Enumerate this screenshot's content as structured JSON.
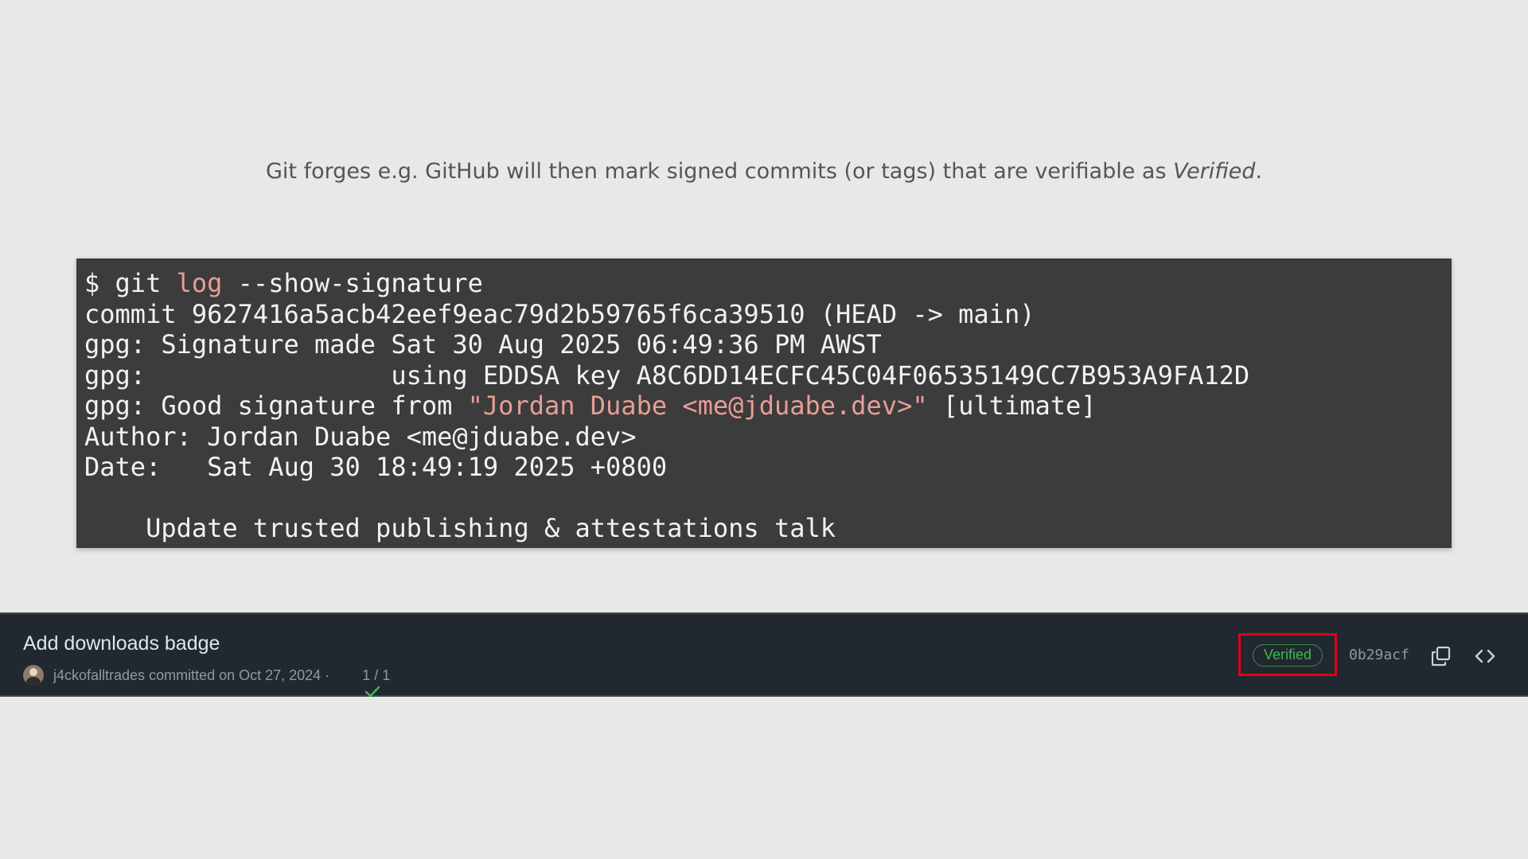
{
  "intro": {
    "text_before": "Git forges e.g. GitHub will then mark signed commits (or tags) that are verifiable as ",
    "emphasis": "Verified",
    "text_after": "."
  },
  "terminal": {
    "line1_prompt": "$ git ",
    "line1_cmd": "log",
    "line1_args": " --show-signature",
    "line2": "commit 9627416a5acb42eef9eac79d2b59765f6ca39510 (HEAD -> main)",
    "line3": "gpg: Signature made Sat 30 Aug 2025 06:49:36 PM AWST",
    "line4": "gpg:                using EDDSA key A8C6DD14ECFC45C04F06535149CC7B953A9FA12D",
    "line5_prefix": "gpg: Good signature from ",
    "line5_string": "\"Jordan Duabe <me@jduabe.dev>\"",
    "line5_suffix": " [ultimate]",
    "line6": "Author: Jordan Duabe <me@jduabe.dev>",
    "line7": "Date:   Sat Aug 30 18:49:19 2025 +0800",
    "line8": "",
    "line9": "    Update trusted publishing & attestations talk"
  },
  "commit": {
    "title": "Add downloads badge",
    "author": "j4ckofalltrades",
    "committed_text": " committed on Oct 27, 2024 · ",
    "checks": "1 / 1",
    "verified_label": "Verified",
    "sha": "0b29acf",
    "icons": {
      "avatar": "avatar",
      "check": "check-icon",
      "copy": "copy-icon",
      "code": "code-icon"
    }
  },
  "colors": {
    "page_bg": "#e7e9e8",
    "terminal_bg": "#3c3c3c",
    "terminal_accent": "#e79e96",
    "commit_bg": "#212830",
    "verified_green": "#3fb950",
    "highlight_red": "#e2001a"
  }
}
